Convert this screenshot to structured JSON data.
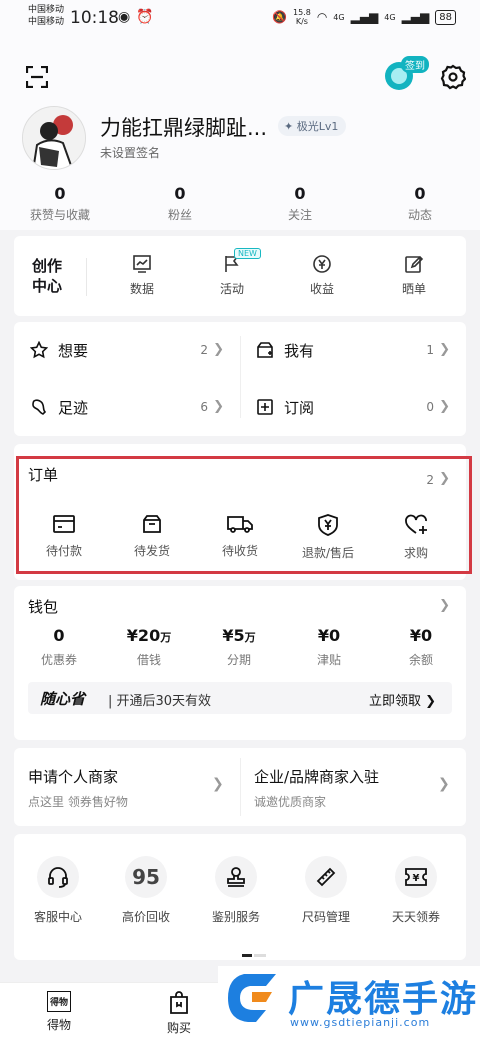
{
  "status_bar": {
    "carrier_1": "中国移动",
    "carrier_2": "中国移动",
    "time": "10:18",
    "net_speed_value": "15.8",
    "net_speed_unit": "K/s",
    "signal_1": "4G",
    "signal_2": "4G",
    "battery": "88"
  },
  "header": {
    "checkin_label": "签到"
  },
  "profile": {
    "username": "力能扛鼎绿脚趾...",
    "level": "极光Lv1",
    "signature": "未设置签名",
    "stats": [
      {
        "value": "0",
        "label": "获赞与收藏"
      },
      {
        "value": "0",
        "label": "粉丝"
      },
      {
        "value": "0",
        "label": "关注"
      },
      {
        "value": "0",
        "label": "动态"
      }
    ]
  },
  "creator": {
    "title": "创作中心",
    "items": [
      {
        "label": "数据",
        "icon": "chart-icon"
      },
      {
        "label": "活动",
        "icon": "flag-icon"
      },
      {
        "label": "收益",
        "icon": "yuan-coin-icon"
      },
      {
        "label": "晒单",
        "icon": "edit-icon"
      }
    ],
    "new_badge": "NEW"
  },
  "collections": {
    "want": {
      "label": "想要",
      "count": "2"
    },
    "have": {
      "label": "我有",
      "count": "1"
    },
    "history": {
      "label": "足迹",
      "count": "6"
    },
    "subscribe": {
      "label": "订阅",
      "count": "0"
    }
  },
  "orders": {
    "title": "订单",
    "count": "2",
    "items": [
      {
        "label": "待付款",
        "icon": "card-icon"
      },
      {
        "label": "待发货",
        "icon": "box-icon"
      },
      {
        "label": "待收货",
        "icon": "truck-icon"
      },
      {
        "label": "退款/售后",
        "icon": "shield-yuan-icon"
      },
      {
        "label": "求购",
        "icon": "heart-plus-icon"
      }
    ]
  },
  "wallet": {
    "title": "钱包",
    "items": [
      {
        "value": "0",
        "unit": "",
        "label": "优惠券"
      },
      {
        "value": "¥20",
        "unit": "万",
        "label": "借钱"
      },
      {
        "value": "¥5",
        "unit": "万",
        "label": "分期"
      },
      {
        "value": "¥0",
        "unit": "",
        "label": "津贴"
      },
      {
        "value": "¥0",
        "unit": "",
        "label": "余额"
      }
    ],
    "promo_logo": "随心省",
    "promo_text": "| 开通后30天有效",
    "promo_cta": "立即领取"
  },
  "merchant": {
    "personal_title": "申请个人商家",
    "personal_sub": "点这里 领券售好物",
    "brand_title": "企业/品牌商家入驻",
    "brand_sub": "诚邀优质商家"
  },
  "services": [
    {
      "label": "客服中心",
      "glyph": "",
      "icon": "headset-icon"
    },
    {
      "label": "高价回收",
      "glyph": "95",
      "icon": "recycle-95-icon"
    },
    {
      "label": "鉴别服务",
      "glyph": "",
      "icon": "stamp-icon"
    },
    {
      "label": "尺码管理",
      "glyph": "",
      "icon": "ruler-icon"
    },
    {
      "label": "天天领券",
      "glyph": "¥",
      "icon": "ticket-icon"
    }
  ],
  "bottom_nav": [
    {
      "label": "得物",
      "glyph": "得物"
    },
    {
      "label": "购买",
      "glyph": ""
    }
  ],
  "watermark": {
    "title": "广晟德手游",
    "url": "www.gsdtiepianji.com"
  },
  "colors": {
    "accent_teal": "#12b3c0",
    "highlight_red": "#d33a43",
    "watermark_blue": "#1d7fe0"
  }
}
